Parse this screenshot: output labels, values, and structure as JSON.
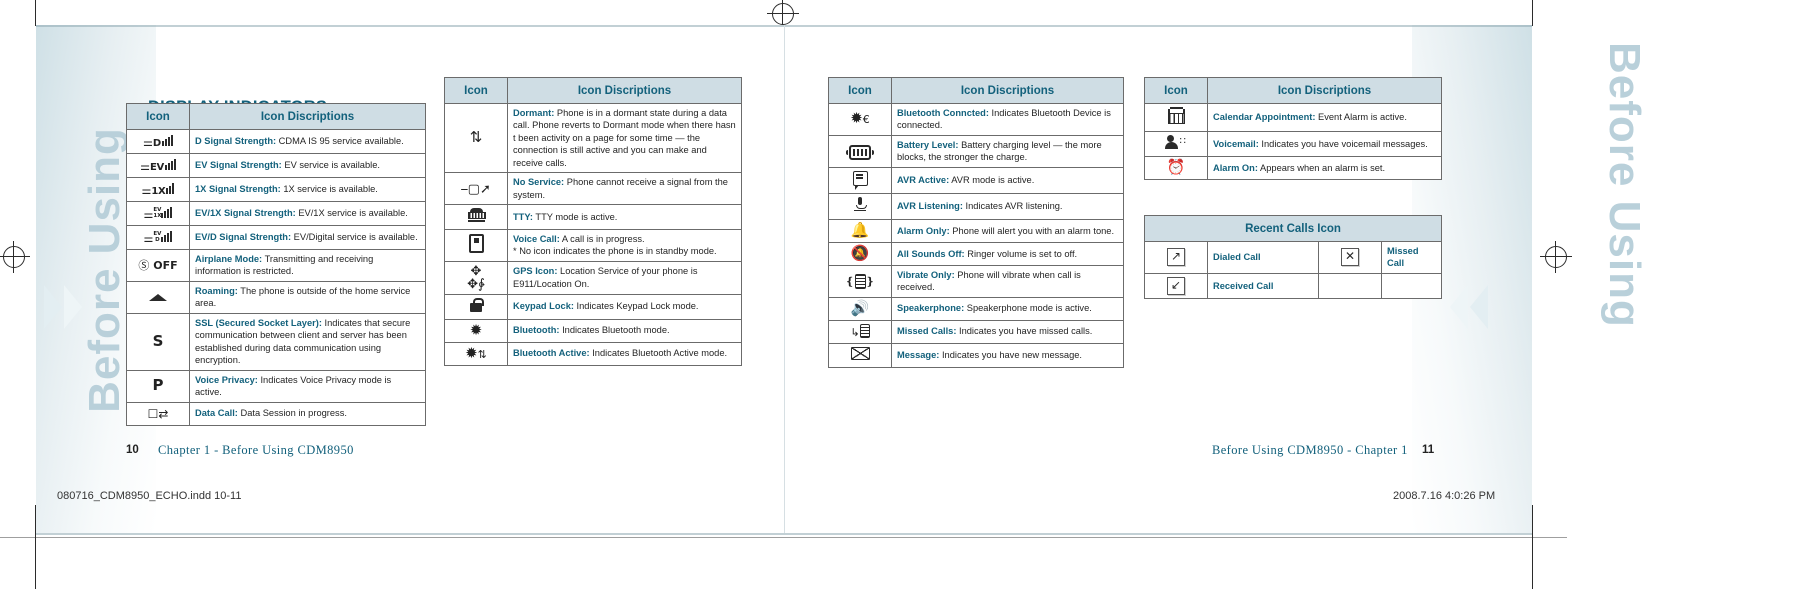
{
  "document": {
    "section_title": "DISPLAY INDICATORS",
    "side_text_left": "Before Using",
    "side_text_right": "Before Using",
    "left_page_number": "10",
    "right_page_number": "11",
    "left_footer": "Chapter 1  -  Before Using CDM8950",
    "right_footer": "Before Using CDM8950  -  Chapter 1",
    "print_filename": "080716_CDM8950_ECHO.indd   10-11",
    "print_timestamp": "2008.7.16   4:0:26 PM"
  },
  "colors": {
    "accent": "#13617c",
    "header_bg": "#cfdde4",
    "border": "#6b6b6b",
    "side_text": "#b9d0da"
  },
  "headers": {
    "icon": "Icon",
    "description": "Icon Discriptions",
    "recent_calls": "Recent Calls Icon"
  },
  "table1": {
    "rows": [
      {
        "icon_name": "signal-strength-d-icon",
        "icon_text": "D",
        "bars": 4,
        "label": "D Signal Strength:",
        "text": " CDMA IS 95 service available."
      },
      {
        "icon_name": "signal-strength-ev-icon",
        "icon_text": "EV",
        "bars": 4,
        "label": "EV Signal Strength:",
        "text": "  EV service is available."
      },
      {
        "icon_name": "signal-strength-1x-icon",
        "icon_text": "1X",
        "bars": 3,
        "label": "1X Signal Strength:",
        "text": "  1X service is available."
      },
      {
        "icon_name": "signal-strength-ev1x-icon",
        "icon_text": "EV\n1X",
        "bars": 4,
        "label": "EV/1X Signal Strength:",
        "text": "  EV/1X service is available."
      },
      {
        "icon_name": "signal-strength-evd-icon",
        "icon_text": "EV\nD",
        "bars": 4,
        "label": "EV/D Signal Strength:",
        "text": "  EV/Digital service is available."
      },
      {
        "icon_name": "airplane-mode-icon",
        "icon_text": "OFF",
        "bars": 0,
        "label": "Airplane Mode:",
        "text": " Transmitting and receiving information is restricted."
      },
      {
        "icon_name": "roaming-icon",
        "icon_text": "▲",
        "bars": 0,
        "label": "Roaming:",
        "text": " The phone is outside of the home service area."
      },
      {
        "icon_name": "ssl-icon",
        "icon_text": "S",
        "bars": 0,
        "label": "SSL (Secured Socket Layer):",
        "text": " Indicates that secure communication between client and server has been established during data communication using encryption."
      },
      {
        "icon_name": "voice-privacy-icon",
        "icon_text": "P",
        "bars": 0,
        "label": "Voice Privacy:",
        "text": " Indicates Voice Privacy mode is active."
      },
      {
        "icon_name": "data-call-icon",
        "icon_text": "⇄",
        "bars": 0,
        "label": "Data Call:",
        "text": " Data Session in progress."
      }
    ]
  },
  "table2": {
    "rows": [
      {
        "icon_name": "dormant-icon",
        "glyph": "⇵",
        "label": "Dormant:",
        "text": " Phone is in a dormant state during a data call. Phone reverts to Dormant mode when there hasn t been activity on a page for some time — the connection is still active and you can make and receive calls."
      },
      {
        "icon_name": "no-service-icon",
        "glyph": "⌁",
        "label": "No Service:",
        "text": " Phone cannot receive a signal from the system."
      },
      {
        "icon_name": "tty-icon",
        "glyph": "⌨",
        "label": "TTY:",
        "text": " TTY mode is active."
      },
      {
        "icon_name": "voice-call-icon",
        "glyph": "▯",
        "label": "Voice Call:",
        "text": " A call is in progress.",
        "text2": "* No icon indicates the phone is in standby mode."
      },
      {
        "icon_name": "gps-icon",
        "glyph": "✥",
        "label": "GPS Icon:",
        "text": " Location Service of your phone is E911/Location On."
      },
      {
        "icon_name": "keypad-lock-icon",
        "glyph": "🔒",
        "label": "Keypad Lock:",
        "text": " Indicates Keypad Lock mode."
      },
      {
        "icon_name": "bluetooth-icon",
        "glyph": "✻",
        "label": "Bluetooth:",
        "text": " Indicates Bluetooth mode."
      },
      {
        "icon_name": "bluetooth-active-icon",
        "glyph": "✻⇵",
        "label": "Bluetooth Active:",
        "text": " Indicates Bluetooth Active mode."
      }
    ]
  },
  "table3": {
    "rows": [
      {
        "icon_name": "bluetooth-connected-icon",
        "glyph": "✻€",
        "label": "Bluetooth Conncted:",
        "text": " Indicates Bluetooth Device is connected."
      },
      {
        "icon_name": "battery-level-icon",
        "glyph": "battery",
        "label": "Battery Level:",
        "text": " Battery charging level — the more blocks, the stronger the charge."
      },
      {
        "icon_name": "avr-active-icon",
        "glyph": "🗩",
        "label": "AVR Active:",
        "text": " AVR mode is active."
      },
      {
        "icon_name": "avr-listening-icon",
        "glyph": "🎤",
        "label": "AVR Listening:",
        "text": " Indicates AVR listening."
      },
      {
        "icon_name": "alarm-only-icon",
        "glyph": "🔔",
        "label": "Alarm Only:",
        "text": " Phone will alert you with an alarm tone."
      },
      {
        "icon_name": "all-sounds-off-icon",
        "glyph": "🔕",
        "label": "All Sounds Off:",
        "text": " Ringer volume is set to off."
      },
      {
        "icon_name": "vibrate-only-icon",
        "glyph": "((▤))",
        "label": "Vibrate Only:",
        "text": " Phone will vibrate when call is received."
      },
      {
        "icon_name": "speakerphone-icon",
        "glyph": "🔊",
        "label": "Speakerphone:",
        "text": " Speakerphone mode is active."
      },
      {
        "icon_name": "missed-calls-icon",
        "glyph": "↳▤",
        "label": "Missed Calls:",
        "text": " Indicates you have missed calls."
      },
      {
        "icon_name": "message-icon",
        "glyph": "✉",
        "label": "Message:",
        "text": " Indicates you have new message."
      }
    ]
  },
  "table4": {
    "rows": [
      {
        "icon_name": "calendar-appointment-icon",
        "glyph": "▦",
        "label": "Calendar Appointment:",
        "text": " Event Alarm is active."
      },
      {
        "icon_name": "voicemail-icon",
        "glyph": "👤",
        "label": "Voicemail:",
        "text": " Indicates you have voicemail messages."
      },
      {
        "icon_name": "alarm-on-icon",
        "glyph": "⏰",
        "label": "Alarm On:",
        "text": " Appears when an alarm is set."
      }
    ]
  },
  "recent_calls": {
    "cells": [
      {
        "icon_name": "dialed-call-icon",
        "glyph": "↗",
        "label": "Dialed Call"
      },
      {
        "icon_name": "missed-call-icon",
        "glyph": "✕",
        "label": "Missed Call"
      },
      {
        "icon_name": "received-call-icon",
        "glyph": "↙",
        "label": "Received Call"
      },
      {
        "icon_name": "empty-cell",
        "glyph": "",
        "label": ""
      }
    ]
  }
}
